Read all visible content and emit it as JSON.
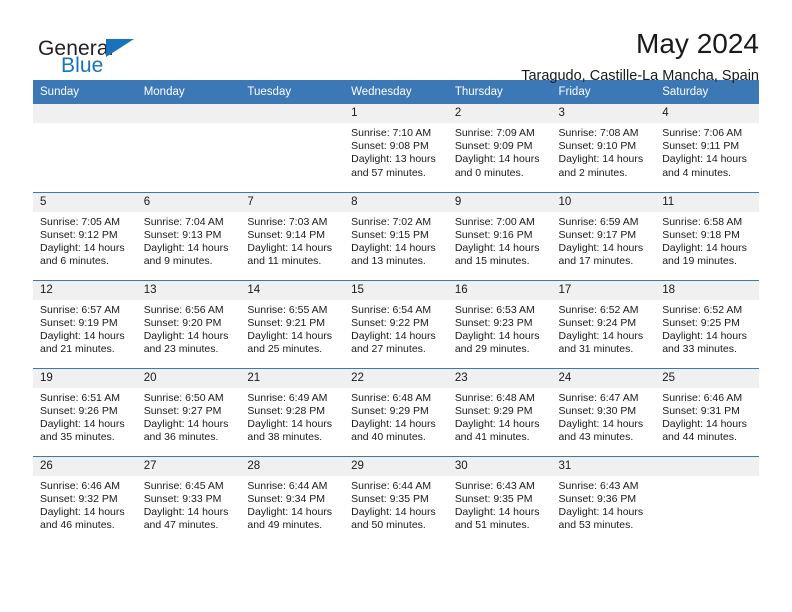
{
  "brand": {
    "name_part1": "General",
    "name_part2": "Blue",
    "triangle_color": "#1673bc"
  },
  "header": {
    "title": "May 2024",
    "subtitle": "Taragudo, Castille-La Mancha, Spain"
  },
  "theme": {
    "header_bg": "#3b78b5",
    "daynum_bg": "#f0f0f0",
    "text": "#1a1a1a"
  },
  "weekdays": [
    "Sunday",
    "Monday",
    "Tuesday",
    "Wednesday",
    "Thursday",
    "Friday",
    "Saturday"
  ],
  "labels": {
    "sunrise_prefix": "Sunrise:",
    "sunset_prefix": "Sunset:",
    "daylight_prefix": "Daylight:"
  },
  "weeks": [
    [
      {
        "day": "",
        "empty": true
      },
      {
        "day": "",
        "empty": true
      },
      {
        "day": "",
        "empty": true
      },
      {
        "day": "1",
        "sunrise": "Sunrise: 7:10 AM",
        "sunset": "Sunset: 9:08 PM",
        "daylight_line1": "Daylight: 13 hours",
        "daylight_line2": "and 57 minutes."
      },
      {
        "day": "2",
        "sunrise": "Sunrise: 7:09 AM",
        "sunset": "Sunset: 9:09 PM",
        "daylight_line1": "Daylight: 14 hours",
        "daylight_line2": "and 0 minutes."
      },
      {
        "day": "3",
        "sunrise": "Sunrise: 7:08 AM",
        "sunset": "Sunset: 9:10 PM",
        "daylight_line1": "Daylight: 14 hours",
        "daylight_line2": "and 2 minutes."
      },
      {
        "day": "4",
        "sunrise": "Sunrise: 7:06 AM",
        "sunset": "Sunset: 9:11 PM",
        "daylight_line1": "Daylight: 14 hours",
        "daylight_line2": "and 4 minutes."
      }
    ],
    [
      {
        "day": "5",
        "sunrise": "Sunrise: 7:05 AM",
        "sunset": "Sunset: 9:12 PM",
        "daylight_line1": "Daylight: 14 hours",
        "daylight_line2": "and 6 minutes."
      },
      {
        "day": "6",
        "sunrise": "Sunrise: 7:04 AM",
        "sunset": "Sunset: 9:13 PM",
        "daylight_line1": "Daylight: 14 hours",
        "daylight_line2": "and 9 minutes."
      },
      {
        "day": "7",
        "sunrise": "Sunrise: 7:03 AM",
        "sunset": "Sunset: 9:14 PM",
        "daylight_line1": "Daylight: 14 hours",
        "daylight_line2": "and 11 minutes."
      },
      {
        "day": "8",
        "sunrise": "Sunrise: 7:02 AM",
        "sunset": "Sunset: 9:15 PM",
        "daylight_line1": "Daylight: 14 hours",
        "daylight_line2": "and 13 minutes."
      },
      {
        "day": "9",
        "sunrise": "Sunrise: 7:00 AM",
        "sunset": "Sunset: 9:16 PM",
        "daylight_line1": "Daylight: 14 hours",
        "daylight_line2": "and 15 minutes."
      },
      {
        "day": "10",
        "sunrise": "Sunrise: 6:59 AM",
        "sunset": "Sunset: 9:17 PM",
        "daylight_line1": "Daylight: 14 hours",
        "daylight_line2": "and 17 minutes."
      },
      {
        "day": "11",
        "sunrise": "Sunrise: 6:58 AM",
        "sunset": "Sunset: 9:18 PM",
        "daylight_line1": "Daylight: 14 hours",
        "daylight_line2": "and 19 minutes."
      }
    ],
    [
      {
        "day": "12",
        "sunrise": "Sunrise: 6:57 AM",
        "sunset": "Sunset: 9:19 PM",
        "daylight_line1": "Daylight: 14 hours",
        "daylight_line2": "and 21 minutes."
      },
      {
        "day": "13",
        "sunrise": "Sunrise: 6:56 AM",
        "sunset": "Sunset: 9:20 PM",
        "daylight_line1": "Daylight: 14 hours",
        "daylight_line2": "and 23 minutes."
      },
      {
        "day": "14",
        "sunrise": "Sunrise: 6:55 AM",
        "sunset": "Sunset: 9:21 PM",
        "daylight_line1": "Daylight: 14 hours",
        "daylight_line2": "and 25 minutes."
      },
      {
        "day": "15",
        "sunrise": "Sunrise: 6:54 AM",
        "sunset": "Sunset: 9:22 PM",
        "daylight_line1": "Daylight: 14 hours",
        "daylight_line2": "and 27 minutes."
      },
      {
        "day": "16",
        "sunrise": "Sunrise: 6:53 AM",
        "sunset": "Sunset: 9:23 PM",
        "daylight_line1": "Daylight: 14 hours",
        "daylight_line2": "and 29 minutes."
      },
      {
        "day": "17",
        "sunrise": "Sunrise: 6:52 AM",
        "sunset": "Sunset: 9:24 PM",
        "daylight_line1": "Daylight: 14 hours",
        "daylight_line2": "and 31 minutes."
      },
      {
        "day": "18",
        "sunrise": "Sunrise: 6:52 AM",
        "sunset": "Sunset: 9:25 PM",
        "daylight_line1": "Daylight: 14 hours",
        "daylight_line2": "and 33 minutes."
      }
    ],
    [
      {
        "day": "19",
        "sunrise": "Sunrise: 6:51 AM",
        "sunset": "Sunset: 9:26 PM",
        "daylight_line1": "Daylight: 14 hours",
        "daylight_line2": "and 35 minutes."
      },
      {
        "day": "20",
        "sunrise": "Sunrise: 6:50 AM",
        "sunset": "Sunset: 9:27 PM",
        "daylight_line1": "Daylight: 14 hours",
        "daylight_line2": "and 36 minutes."
      },
      {
        "day": "21",
        "sunrise": "Sunrise: 6:49 AM",
        "sunset": "Sunset: 9:28 PM",
        "daylight_line1": "Daylight: 14 hours",
        "daylight_line2": "and 38 minutes."
      },
      {
        "day": "22",
        "sunrise": "Sunrise: 6:48 AM",
        "sunset": "Sunset: 9:29 PM",
        "daylight_line1": "Daylight: 14 hours",
        "daylight_line2": "and 40 minutes."
      },
      {
        "day": "23",
        "sunrise": "Sunrise: 6:48 AM",
        "sunset": "Sunset: 9:29 PM",
        "daylight_line1": "Daylight: 14 hours",
        "daylight_line2": "and 41 minutes."
      },
      {
        "day": "24",
        "sunrise": "Sunrise: 6:47 AM",
        "sunset": "Sunset: 9:30 PM",
        "daylight_line1": "Daylight: 14 hours",
        "daylight_line2": "and 43 minutes."
      },
      {
        "day": "25",
        "sunrise": "Sunrise: 6:46 AM",
        "sunset": "Sunset: 9:31 PM",
        "daylight_line1": "Daylight: 14 hours",
        "daylight_line2": "and 44 minutes."
      }
    ],
    [
      {
        "day": "26",
        "sunrise": "Sunrise: 6:46 AM",
        "sunset": "Sunset: 9:32 PM",
        "daylight_line1": "Daylight: 14 hours",
        "daylight_line2": "and 46 minutes."
      },
      {
        "day": "27",
        "sunrise": "Sunrise: 6:45 AM",
        "sunset": "Sunset: 9:33 PM",
        "daylight_line1": "Daylight: 14 hours",
        "daylight_line2": "and 47 minutes."
      },
      {
        "day": "28",
        "sunrise": "Sunrise: 6:44 AM",
        "sunset": "Sunset: 9:34 PM",
        "daylight_line1": "Daylight: 14 hours",
        "daylight_line2": "and 49 minutes."
      },
      {
        "day": "29",
        "sunrise": "Sunrise: 6:44 AM",
        "sunset": "Sunset: 9:35 PM",
        "daylight_line1": "Daylight: 14 hours",
        "daylight_line2": "and 50 minutes."
      },
      {
        "day": "30",
        "sunrise": "Sunrise: 6:43 AM",
        "sunset": "Sunset: 9:35 PM",
        "daylight_line1": "Daylight: 14 hours",
        "daylight_line2": "and 51 minutes."
      },
      {
        "day": "31",
        "sunrise": "Sunrise: 6:43 AM",
        "sunset": "Sunset: 9:36 PM",
        "daylight_line1": "Daylight: 14 hours",
        "daylight_line2": "and 53 minutes."
      },
      {
        "day": "",
        "empty": true
      }
    ]
  ]
}
